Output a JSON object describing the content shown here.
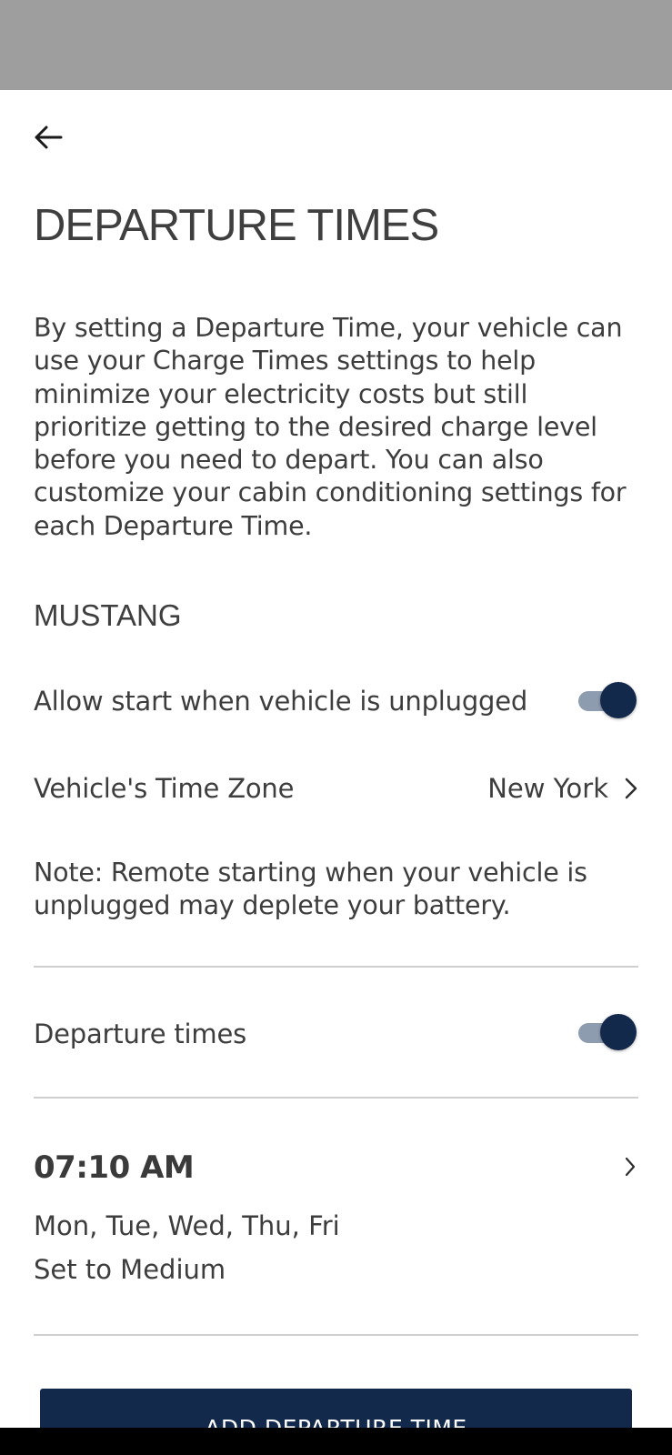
{
  "header": {
    "back_icon": "arrow-left-icon",
    "title": "DEPARTURE TIMES"
  },
  "description": "By setting a Departure Time, your vehicle can use your Charge Times settings to help minimize your electricity costs but still prioritize getting to the desired charge level before you need to depart. You can also customize your cabin conditioning settings for each Departure Time.",
  "vehicle": {
    "name": "MUSTANG",
    "allow_unplugged": {
      "label": "Allow start when vehicle is unplugged",
      "enabled": true
    },
    "time_zone": {
      "label": "Vehicle's Time Zone",
      "value": "New York",
      "icon": "chevron-right-icon"
    },
    "note": "Note: Remote starting when your vehicle is unplugged may deplete your battery."
  },
  "departure_times": {
    "label": "Departure times",
    "enabled": true,
    "items": [
      {
        "time": "07:10 AM",
        "days": "Mon, Tue, Wed, Thu, Fri",
        "level": "Set to Medium",
        "icon": "chevron-right-icon"
      }
    ]
  },
  "add_button": {
    "label": "ADD DEPARTURE TIME"
  },
  "colors": {
    "accent": "#13294b",
    "toggle_track": "#8e9cb0",
    "status_bar": "#9e9e9e",
    "divider": "#cfcfcf"
  }
}
